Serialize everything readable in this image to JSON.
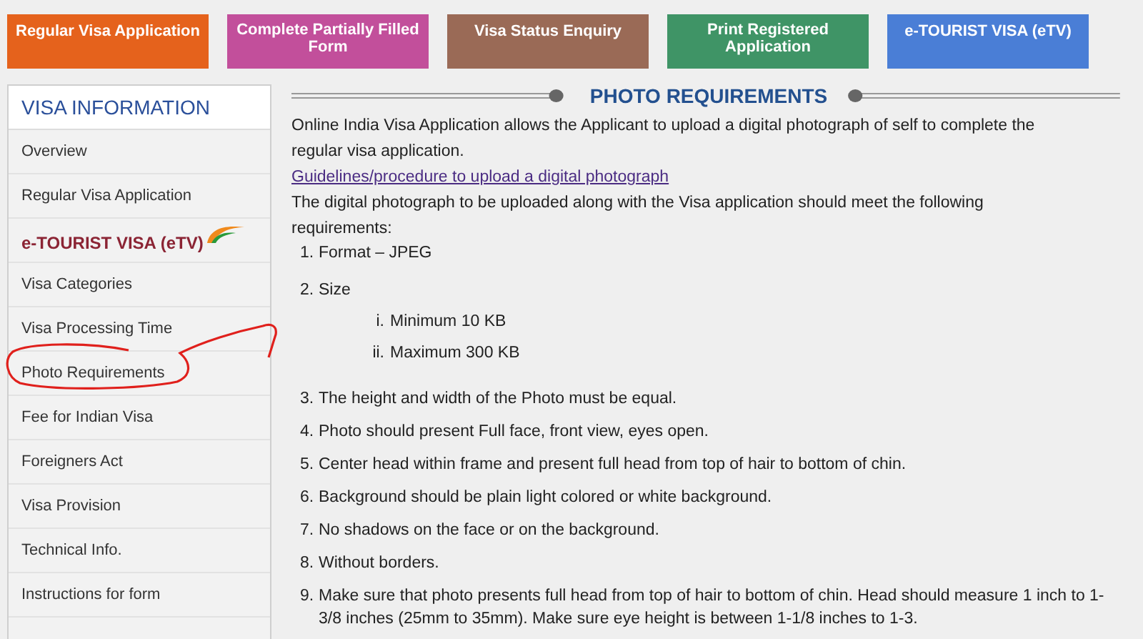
{
  "top_buttons": [
    {
      "label": "Regular Visa Application",
      "color": "#e5621c"
    },
    {
      "label": "Complete Partially Filled Form",
      "color": "#c24f9b"
    },
    {
      "label": "Visa Status Enquiry",
      "color": "#9a6a56"
    },
    {
      "label": "Print Registered Application",
      "color": "#3f9466"
    },
    {
      "label": "e-TOURIST VISA (eTV)",
      "color": "#4a7ed6"
    }
  ],
  "sidebar": {
    "title": "VISA INFORMATION",
    "items": [
      {
        "kind": "link",
        "label": "Overview"
      },
      {
        "kind": "link",
        "label": "Regular Visa Application"
      },
      {
        "kind": "heading",
        "label": "e-TOURIST VISA (eTV)"
      },
      {
        "kind": "link",
        "label": "Visa Categories"
      },
      {
        "kind": "link",
        "label": "Visa Processing Time"
      },
      {
        "kind": "link",
        "label": "Photo Requirements"
      },
      {
        "kind": "link",
        "label": "Fee for Indian Visa"
      },
      {
        "kind": "link",
        "label": "Foreigners Act"
      },
      {
        "kind": "link",
        "label": "Visa Provision"
      },
      {
        "kind": "link",
        "label": "Technical Info."
      },
      {
        "kind": "link",
        "label": "Instructions for form"
      }
    ]
  },
  "content": {
    "title": "PHOTO REQUIREMENTS",
    "intro": "Online India Visa Application allows the Applicant to upload a digital photograph of self to complete the regular visa application.",
    "link": "Guidelines/procedure to upload a digital photograph",
    "lead": "The digital photograph to be uploaded along with the Visa application should meet the following requirements:",
    "requirements": [
      {
        "number": "1.",
        "text": "Format – JPEG"
      },
      {
        "number": "2.",
        "text": "Size",
        "children": [
          {
            "number": "i.",
            "text": "Minimum 10 KB"
          },
          {
            "number": "ii.",
            "text": "Maximum 300 KB"
          }
        ]
      },
      {
        "number": "3.",
        "text": "The height and width of the Photo must be equal."
      },
      {
        "number": "4.",
        "text": "Photo should present Full face, front view, eyes open."
      },
      {
        "number": "5.",
        "text": "Center head within frame and present full head from top of hair to bottom of chin."
      },
      {
        "number": "6.",
        "text": "Background should be plain light colored or white background."
      },
      {
        "number": "7.",
        "text": "No shadows on the face or on the background."
      },
      {
        "number": "8.",
        "text": "Without borders."
      },
      {
        "number": "9.",
        "text": "Make sure that photo presents full head from top of hair to bottom of chin. Head should measure 1 inch to 1-3/8 inches (25mm to 35mm). Make sure eye height is between 1-1/8 inches to 1-3."
      }
    ]
  }
}
